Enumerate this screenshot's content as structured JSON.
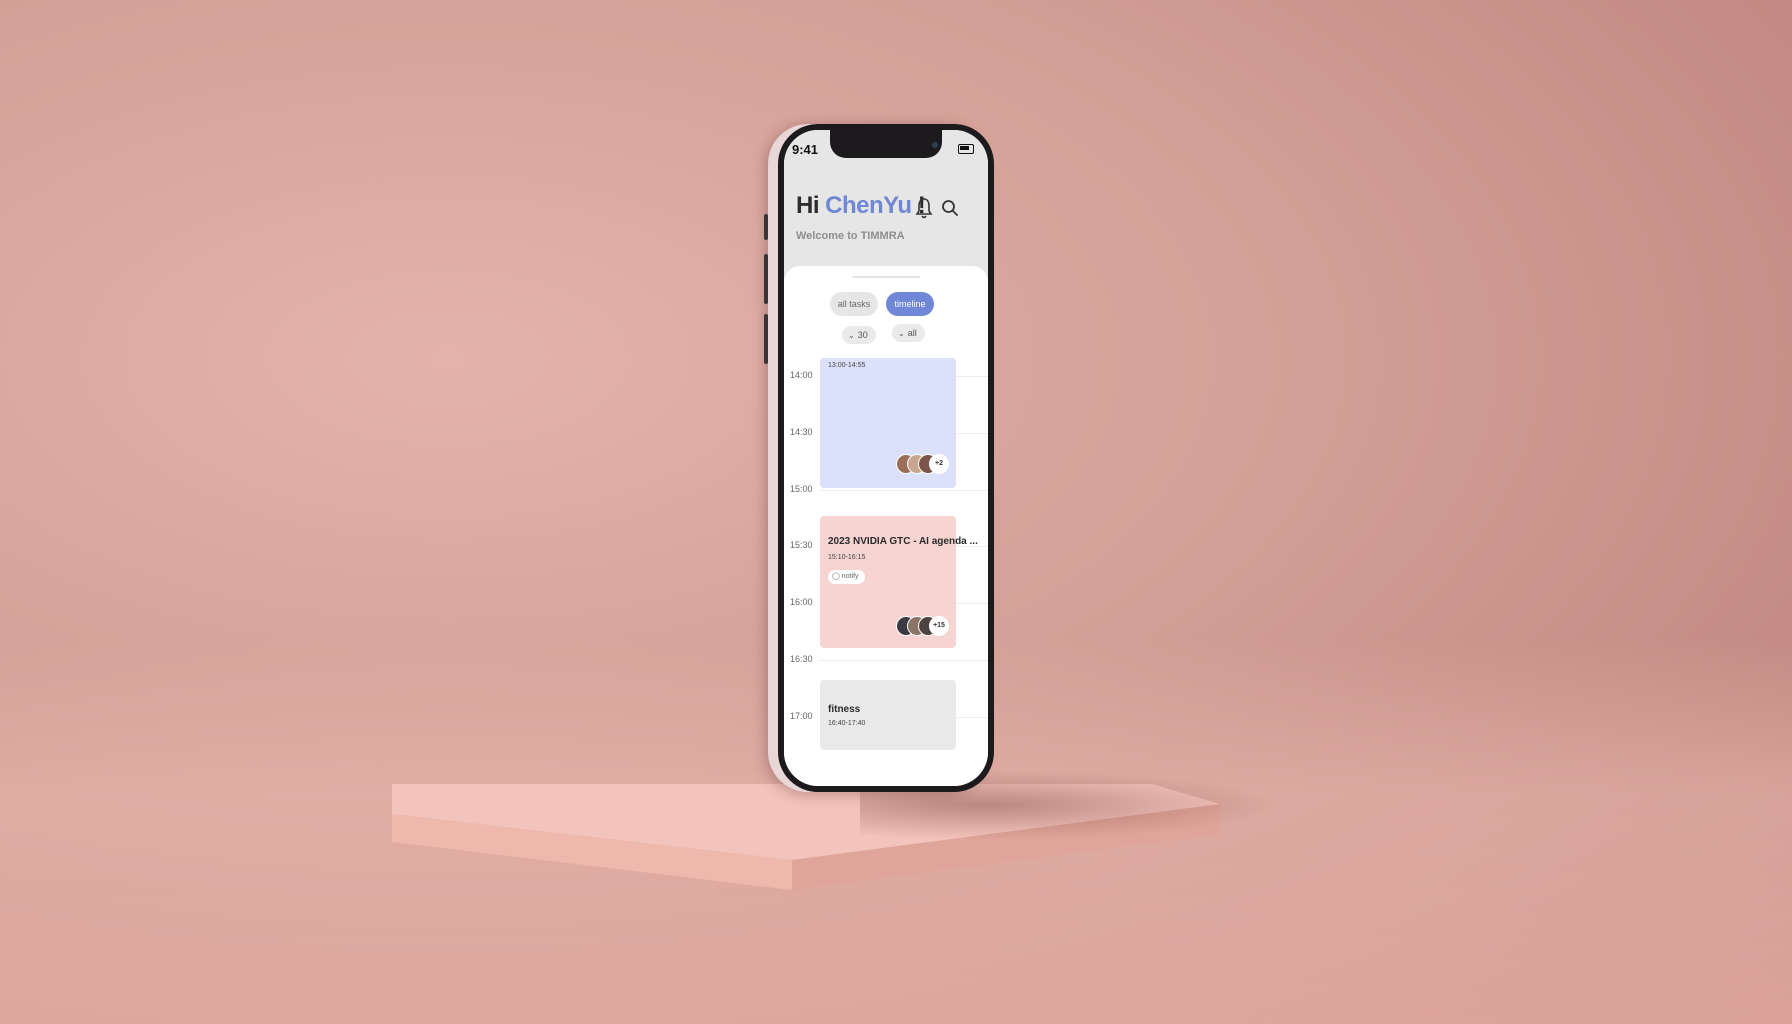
{
  "status_bar": {
    "time": "9:41"
  },
  "header": {
    "greeting_prefix": "Hi",
    "user_name": "ChenYu",
    "greeting_suffix": "!",
    "welcome_text": "Welcome to TIMMRA"
  },
  "icons": {
    "notification": "bell-icon",
    "search": "search-icon"
  },
  "tabs": [
    {
      "label": "all tasks",
      "active": false
    },
    {
      "label": "timeline",
      "active": true
    }
  ],
  "filters": [
    {
      "value": "30"
    },
    {
      "value": "all"
    }
  ],
  "timeline": {
    "hours": [
      "14:00",
      "14:30",
      "15:00",
      "15:30",
      "16:00",
      "16:30",
      "17:00"
    ],
    "events": [
      {
        "title": "",
        "time": "13:00-14:55",
        "color": "#dce1fb",
        "participants_extra": "+2"
      },
      {
        "title": "2023 NVIDIA GTC - AI agenda ...",
        "time": "15:10-16:15",
        "notify_label": "notify",
        "color": "#f6d4d2",
        "participants_extra": "+15"
      },
      {
        "title": "fitness",
        "time": "16:40-17:40",
        "color": "#e9e9e9"
      }
    ]
  },
  "colors": {
    "accent": "#6f87d6",
    "background": "#d8a69d"
  }
}
